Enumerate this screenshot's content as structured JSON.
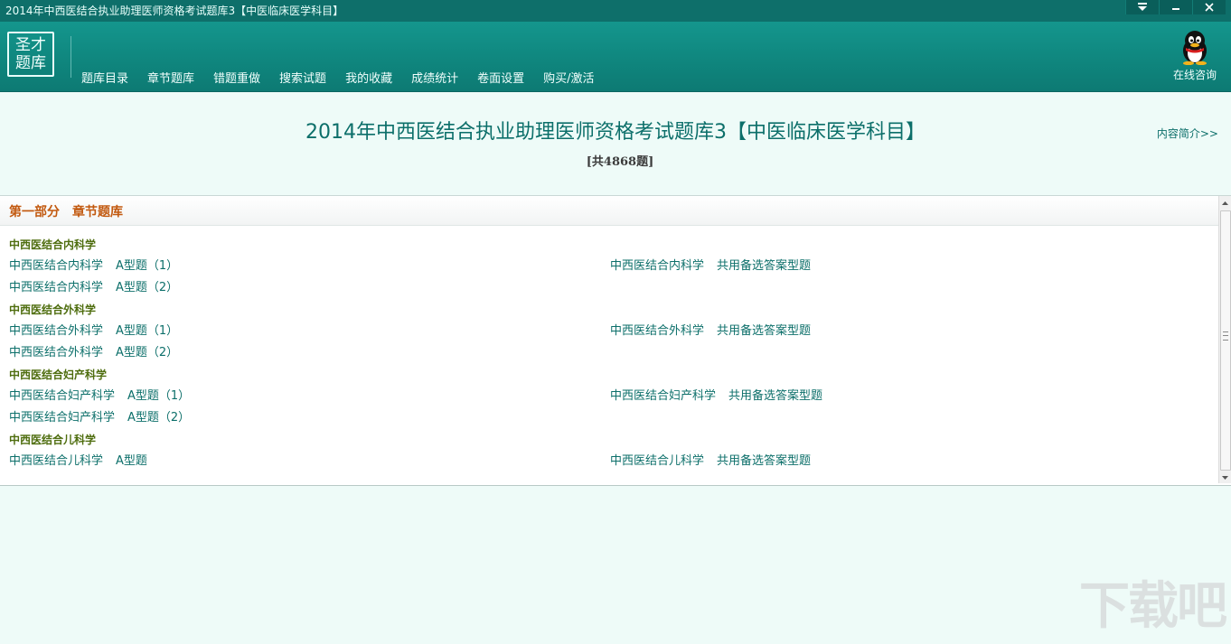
{
  "window": {
    "title": "2014年中西医结合执业助理医师资格考试题库3【中医临床医学科目】",
    "controls": [
      "menu-dropdown-icon",
      "minimize-icon",
      "close-icon"
    ]
  },
  "header": {
    "logo_text": [
      "圣才",
      "题库"
    ],
    "nav": [
      "题库目录",
      "章节题库",
      "错题重做",
      "搜索试题",
      "我的收藏",
      "成绩统计",
      "卷面设置",
      "购买/激活"
    ],
    "qq_label": "在线咨询"
  },
  "book": {
    "title": "2014年中西医结合执业助理医师资格考试题库3【中医临床医学科目】",
    "count": "[共4868题]",
    "intro_link": "内容简介>>"
  },
  "section": {
    "title": "第一部分　章节题库",
    "categories": [
      {
        "name": "中西医结合内科学",
        "rows": [
          {
            "left": [
              "中西医结合内科学",
              "A型题（1）"
            ],
            "right": [
              "中西医结合内科学",
              "共用备选答案型题"
            ]
          },
          {
            "left": [
              "中西医结合内科学",
              "A型题（2）"
            ]
          }
        ]
      },
      {
        "name": "中西医结合外科学",
        "rows": [
          {
            "left": [
              "中西医结合外科学",
              "A型题（1）"
            ],
            "right": [
              "中西医结合外科学",
              "共用备选答案型题"
            ]
          },
          {
            "left": [
              "中西医结合外科学",
              "A型题（2）"
            ]
          }
        ]
      },
      {
        "name": "中西医结合妇产科学",
        "rows": [
          {
            "left": [
              "中西医结合妇产科学",
              "A型题（1）"
            ],
            "right": [
              "中西医结合妇产科学",
              "共用备选答案型题"
            ]
          },
          {
            "left": [
              "中西医结合妇产科学",
              "A型题（2）"
            ]
          }
        ]
      },
      {
        "name": "中西医结合儿科学",
        "rows": [
          {
            "left": [
              "中西医结合儿科学",
              "A型题"
            ],
            "right": [
              "中西医结合儿科学",
              "共用备选答案型题"
            ]
          }
        ]
      }
    ]
  },
  "watermark": "下载吧",
  "colors": {
    "header": "#0f857d",
    "background": "#eefbf8",
    "link": "#0c6f6a",
    "section_title": "#c2590f",
    "category": "#4e6d0e"
  }
}
